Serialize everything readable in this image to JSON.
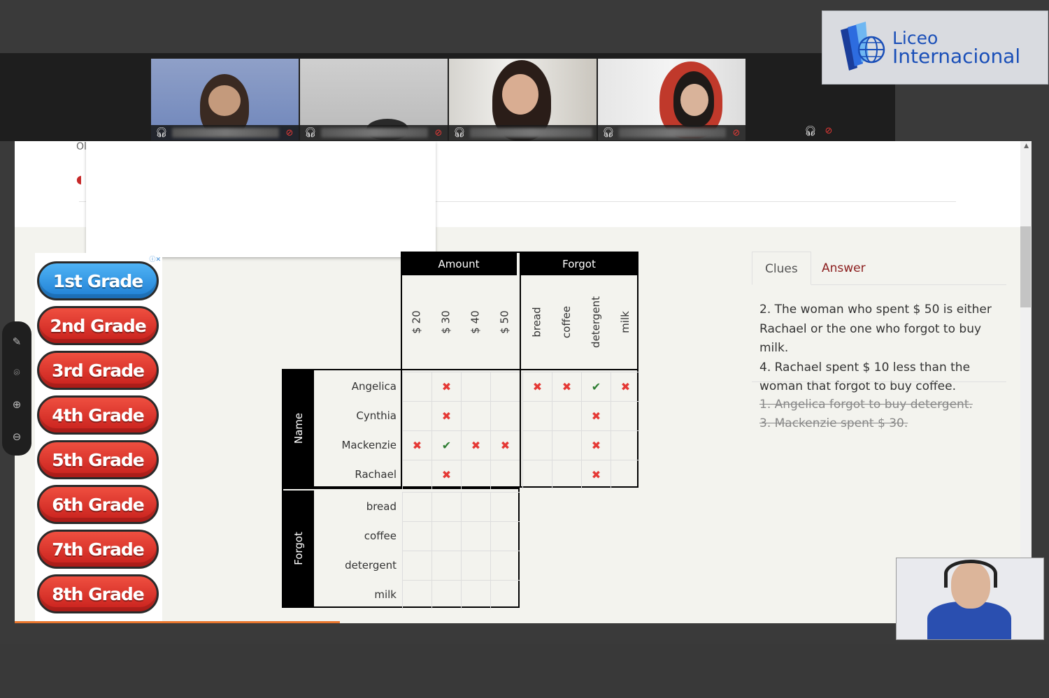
{
  "logo": {
    "line1": "Liceo",
    "line2": "Internacional"
  },
  "share": {
    "stub_text": "Ol"
  },
  "grades": [
    "1st Grade",
    "2nd Grade",
    "3rd Grade",
    "4th Grade",
    "5th Grade",
    "6th Grade",
    "7th Grade",
    "8th Grade"
  ],
  "grid": {
    "amount_header": "Amount",
    "forgot_header": "Forgot",
    "name_header": "Name",
    "forgot_row_header": "Forgot",
    "amounts": [
      "$ 20",
      "$ 30",
      "$ 40",
      "$ 50"
    ],
    "forgot_items": [
      "bread",
      "coffee",
      "detergent",
      "milk"
    ],
    "names": [
      "Angelica",
      "Cynthia",
      "Mackenzie",
      "Rachael"
    ],
    "forgot_rows": [
      "bread",
      "coffee",
      "detergent",
      "milk"
    ],
    "marks": {
      "name_amount": [
        [
          "",
          "x",
          "",
          ""
        ],
        [
          "",
          "x",
          "",
          ""
        ],
        [
          "x",
          "v",
          "x",
          "x"
        ],
        [
          "",
          "x",
          "",
          ""
        ]
      ],
      "name_forgot": [
        [
          "x",
          "x",
          "v",
          "x"
        ],
        [
          "",
          "",
          "x",
          ""
        ],
        [
          "",
          "",
          "x",
          ""
        ],
        [
          "",
          "",
          "x",
          ""
        ]
      ],
      "forgot_amount": [
        [
          "",
          "",
          "",
          ""
        ],
        [
          "",
          "",
          "",
          ""
        ],
        [
          "",
          "",
          "",
          ""
        ],
        [
          "",
          "",
          "",
          ""
        ]
      ]
    }
  },
  "tabs": {
    "clues": "Clues",
    "answer": "Answer"
  },
  "clues": {
    "active": [
      "2. The woman who spent $ 50 is either Rachael or the one who forgot to buy milk.",
      "4. Rachael spent $ 10 less than the woman that forgot to buy coffee."
    ],
    "done": [
      "1. Angelica forgot to buy detergent.",
      "3. Mackenzie spent $ 30."
    ]
  },
  "icons": {
    "participant_audio": "headphones-icon",
    "participant_mic": "mic-off-icon",
    "toolbar": [
      "pen-icon",
      "broadcast-icon",
      "zoom-in-icon",
      "zoom-out-icon"
    ]
  },
  "colors": {
    "cross": "#e53935",
    "tick": "#2e7d32",
    "answer_tab": "#8b1d1d",
    "logo": "#1a4fb8"
  }
}
